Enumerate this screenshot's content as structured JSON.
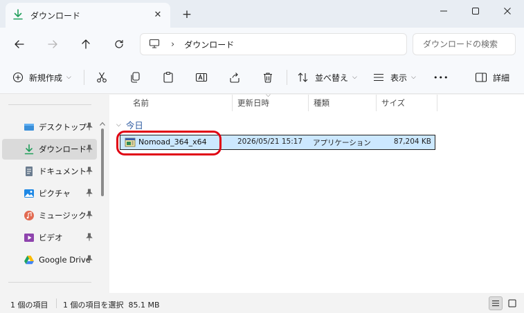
{
  "tab": {
    "title": "ダウンロード",
    "close": "✕",
    "new_tab": "+"
  },
  "window_controls": {
    "minimize": "minimize-icon",
    "maximize": "maximize-icon",
    "close": "close-icon"
  },
  "nav": {
    "address_path": "ダウンロード",
    "address_sep": "›",
    "search_placeholder": "ダウンロードの検索"
  },
  "toolbar": {
    "new_label": "新規作成",
    "sort_label": "並べ替え",
    "view_label": "表示",
    "more_label": "•••",
    "details_label": "詳細"
  },
  "sidebar": {
    "items": [
      {
        "label": "デスクトップ",
        "icon": "desktop-icon",
        "pinned": true
      },
      {
        "label": "ダウンロード",
        "icon": "download-icon",
        "pinned": true,
        "active": true
      },
      {
        "label": "ドキュメント",
        "icon": "document-icon",
        "pinned": true
      },
      {
        "label": "ピクチャ",
        "icon": "pictures-icon",
        "pinned": true
      },
      {
        "label": "ミュージック",
        "icon": "music-icon",
        "pinned": true
      },
      {
        "label": "ビデオ",
        "icon": "video-icon",
        "pinned": true
      },
      {
        "label": "Google Drive",
        "icon": "google-drive-icon",
        "pinned": true
      }
    ]
  },
  "columns": {
    "name": "名前",
    "modified": "更新日時",
    "type": "種類",
    "size": "サイズ"
  },
  "group": {
    "label": "今日"
  },
  "files": [
    {
      "name": "Nomoad_364_x64",
      "modified": "2026/05/21 15:17",
      "type": "アプリケーション",
      "size": "87,204 KB",
      "selected": true
    }
  ],
  "status": {
    "item_count": "1 個の項目",
    "selection": "1 個の項目を選択  85.1 MB"
  },
  "colors": {
    "selection": "#cce8ff",
    "highlight_ring": "#e00012",
    "group_text": "#2c5aa0",
    "download_green": "#1f9e5a"
  }
}
